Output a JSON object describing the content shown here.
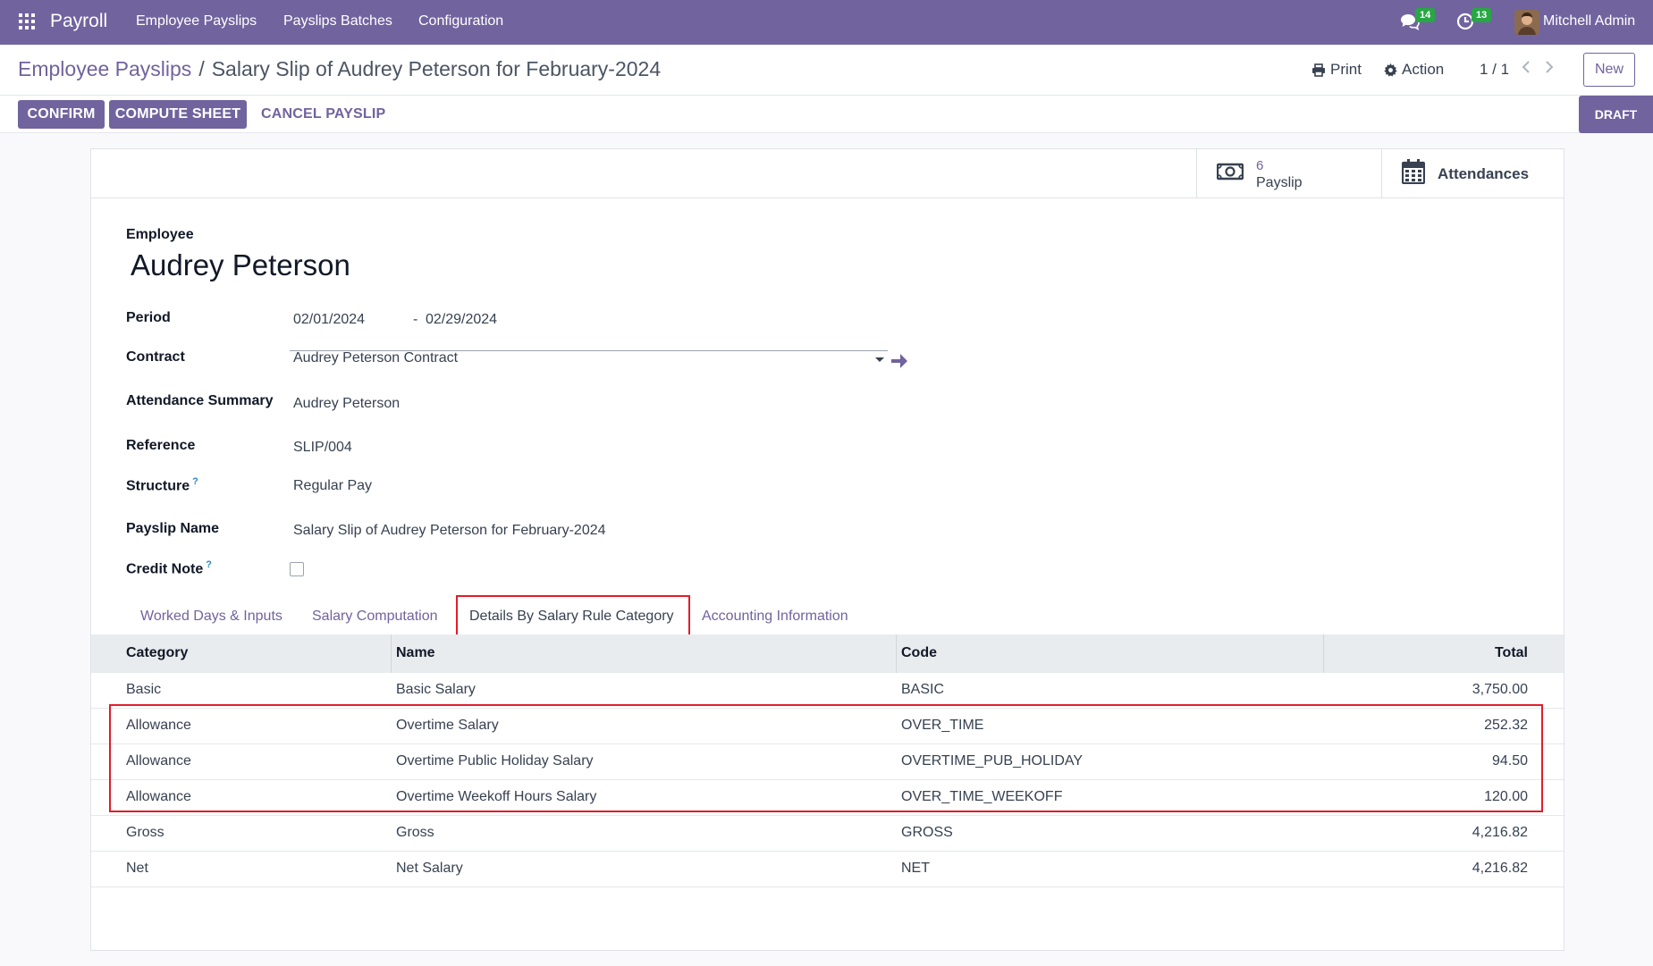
{
  "navbar": {
    "app_name": "Payroll",
    "menu": [
      "Employee Payslips",
      "Payslips Batches",
      "Configuration"
    ],
    "chat_count": "14",
    "activity_count": "13",
    "user_name": "Mitchell Admin"
  },
  "control": {
    "breadcrumb_parent": "Employee Payslips",
    "breadcrumb_separator": "/",
    "breadcrumb_current": "Salary Slip of Audrey Peterson for February-2024",
    "print_label": "Print",
    "action_label": "Action",
    "pager": "1 / 1",
    "new_label": "New"
  },
  "statusbar": {
    "confirm_label": "CONFIRM",
    "compute_label": "COMPUTE SHEET",
    "cancel_label": "CANCEL PAYSLIP",
    "status": "DRAFT"
  },
  "smart_buttons": {
    "payslip_count": "6",
    "payslip_label": "Payslip",
    "attendances_label": "Attendances"
  },
  "form": {
    "employee_label": "Employee",
    "employee_name": "Audrey Peterson",
    "period_label": "Period",
    "period_from": "02/01/2024",
    "period_sep": "-",
    "period_to": "02/29/2024",
    "contract_label": "Contract",
    "contract_value": "Audrey Peterson Contract",
    "attendance_label": "Attendance Summary",
    "attendance_value": "Audrey Peterson",
    "reference_label": "Reference",
    "reference_value": "SLIP/004",
    "structure_label": "Structure",
    "structure_value": "Regular Pay",
    "payslip_name_label": "Payslip Name",
    "payslip_name_value": "Salary Slip of Audrey Peterson for February-2024",
    "credit_note_label": "Credit Note",
    "help_mark": "?"
  },
  "tabs": [
    "Worked Days & Inputs",
    "Salary Computation",
    "Details By Salary Rule Category",
    "Accounting Information"
  ],
  "table": {
    "headers": [
      "Category",
      "Name",
      "Code",
      "Total"
    ],
    "rows": [
      [
        "Basic",
        "Basic Salary",
        "BASIC",
        "3,750.00"
      ],
      [
        "Allowance",
        "Overtime Salary",
        "OVER_TIME",
        "252.32"
      ],
      [
        "Allowance",
        "Overtime Public Holiday Salary",
        "OVERTIME_PUB_HOLIDAY",
        "94.50"
      ],
      [
        "Allowance",
        "Overtime Weekoff Hours Salary",
        "OVER_TIME_WEEKOFF",
        "120.00"
      ],
      [
        "Gross",
        "Gross",
        "GROSS",
        "4,216.82"
      ],
      [
        "Net",
        "Net Salary",
        "NET",
        "4,216.82"
      ]
    ]
  },
  "colors": {
    "brand": "#71639e",
    "highlight": "#e11d2a",
    "badge": "#28a745"
  }
}
